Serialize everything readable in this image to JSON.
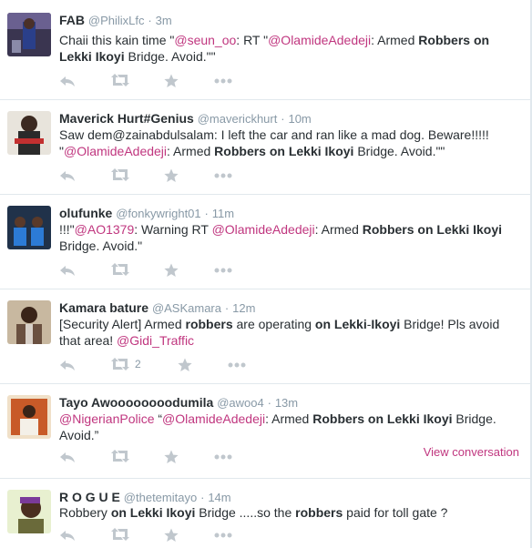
{
  "tweets": [
    {
      "name": "FAB",
      "handle": "@PhilixLfc",
      "time": "3m",
      "segments": [
        {
          "t": "Chaii this kain time \""
        },
        {
          "t": "@seun_oo",
          "m": true
        },
        {
          "t": ": RT \""
        },
        {
          "t": "@OlamideAdedeji",
          "m": true
        },
        {
          "t": ": Armed "
        },
        {
          "t": "Robbers on",
          "b": true
        },
        {
          "t": " "
        },
        {
          "t": "Lekki Ikoyi",
          "b": true
        },
        {
          "t": " Bridge. Avoid.\"\""
        }
      ],
      "retweets": "",
      "view_conversation": ""
    },
    {
      "name": "Maverick Hurt#Genius",
      "handle": "@maverickhurt",
      "time": "10m",
      "segments": [
        {
          "t": "Saw dem@zainabdulsalam: I left the car and ran like a mad dog. Beware!!!!! \""
        },
        {
          "t": "@OlamideAdedeji",
          "m": true
        },
        {
          "t": ": Armed "
        },
        {
          "t": "Robbers on Lekki Ikoyi",
          "b": true
        },
        {
          "t": " Bridge. Avoid.\"\""
        }
      ],
      "retweets": "",
      "view_conversation": ""
    },
    {
      "name": "olufunke",
      "handle": "@fonkywright01",
      "time": "11m",
      "segments": [
        {
          "t": "!!!\""
        },
        {
          "t": "@AO1379",
          "m": true
        },
        {
          "t": ": Warning RT "
        },
        {
          "t": "@OlamideAdedeji",
          "m": true
        },
        {
          "t": ": Armed "
        },
        {
          "t": "Robbers on Lekki Ikoyi",
          "b": true
        },
        {
          "t": " Bridge. Avoid.\""
        }
      ],
      "retweets": "",
      "view_conversation": ""
    },
    {
      "name": "Kamara bature",
      "handle": "@ASKamara",
      "time": "12m",
      "segments": [
        {
          "t": "[Security Alert] Armed "
        },
        {
          "t": "robbers",
          "b": true
        },
        {
          "t": " are operating "
        },
        {
          "t": "on Lekki",
          "b": true
        },
        {
          "t": "-"
        },
        {
          "t": "Ikoyi",
          "b": true
        },
        {
          "t": " Bridge! Pls avoid that area! "
        },
        {
          "t": "@Gidi_Traffic",
          "m": true
        }
      ],
      "retweets": "2",
      "view_conversation": ""
    },
    {
      "name": "Tayo Awoooooooodumila",
      "handle": "@awoo4",
      "time": "13m",
      "segments": [
        {
          "t": "@NigerianPolice",
          "m": true
        },
        {
          "t": " “"
        },
        {
          "t": "@OlamideAdedeji",
          "m": true
        },
        {
          "t": ": Armed "
        },
        {
          "t": "Robbers on Lekki Ikoyi",
          "b": true
        },
        {
          "t": " Bridge. Avoid.”"
        }
      ],
      "retweets": "",
      "view_conversation": "View conversation"
    },
    {
      "name": "R O G U E",
      "handle": "@thetemitayo",
      "time": "14m",
      "segments": [
        {
          "t": "Robbery "
        },
        {
          "t": "on Lekki Ikoyi",
          "b": true
        },
        {
          "t": " Bridge .....so the "
        },
        {
          "t": "robbers",
          "b": true
        },
        {
          "t": " paid for toll gate ?"
        }
      ],
      "retweets": "",
      "view_conversation": ""
    }
  ],
  "separator": "·",
  "icons": {
    "reply": "reply-icon",
    "retweet": "retweet-icon",
    "favorite": "favorite-icon",
    "more": "more-icon"
  },
  "colors": {
    "mention": "#c0367f",
    "muted": "#8899a6",
    "text": "#292f33",
    "divider": "#e1e8ed"
  }
}
